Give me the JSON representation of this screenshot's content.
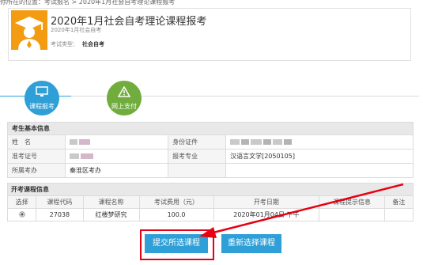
{
  "breadcrumb": {
    "text": "你所在的位置：考试报名 > 2020年1月社会自考理论课程报考"
  },
  "header": {
    "title": "2020年1月社会自考理论课程报考",
    "subtitle_date": "2020年1月社会自考",
    "exam_type_label": "考试类型：",
    "exam_type_value": "社会自考"
  },
  "steps": [
    {
      "label": "课程报考",
      "icon": "monitor-icon",
      "color": "#2f9fd7",
      "active": true
    },
    {
      "label": "网上支付",
      "icon": "warning-icon",
      "color": "#71ad3d",
      "active": false
    }
  ],
  "candidate_info": {
    "section_title": "考生基本信息",
    "name_label": "姓　名",
    "id_label": "身份证件",
    "exam_no_label": "准考证号",
    "major_label": "报考专业",
    "major_value": "汉语言文学[2050105]",
    "office_label": "所属考办",
    "office_value": "秦淮区考办"
  },
  "courses": {
    "section_title": "开考课程信息",
    "headers": [
      "选择",
      "课程代码",
      "课程名称",
      "考试费用（元）",
      "开考日期",
      "课程提示信息",
      "备注"
    ],
    "rows": [
      {
        "select_icon": "radio-selected-icon",
        "code": "27038",
        "name": "红楼梦研究",
        "fee": "100.0",
        "date": "2020年01月04日 下午",
        "hint": "",
        "note": ""
      }
    ]
  },
  "buttons": {
    "submit_label": "提交所选课程",
    "reselect_label": "重新选择课程"
  },
  "colors": {
    "primary": "#2f9fd7",
    "step2": "#71ad3d",
    "avatar": "#f39c12",
    "highlight": "#e60012"
  }
}
